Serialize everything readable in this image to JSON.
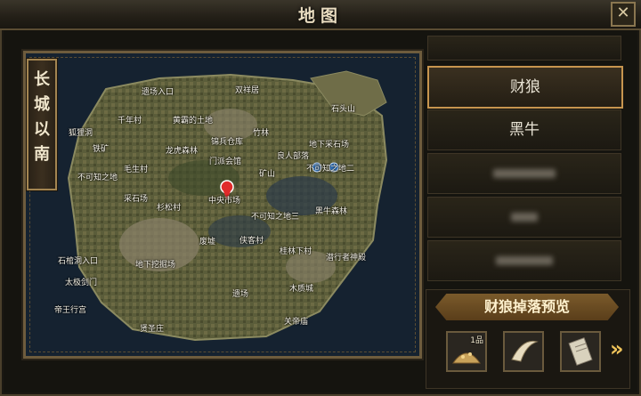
{
  "window": {
    "title": "地图",
    "close_label": "✕"
  },
  "map": {
    "banner_text": [
      "长",
      "城",
      "以",
      "南"
    ],
    "labels": [
      "遗场入口",
      "双祥居",
      "狐狸洞",
      "千年村",
      "黄霸的土地",
      "竹林",
      "石头山",
      "铁矿",
      "龙虎森林",
      "锦兵仓库",
      "良人部落",
      "地下采石场",
      "门派会馆",
      "毛生村",
      "矿山",
      "不可知之地",
      "不可知之地二",
      "采石场",
      "中央市场",
      "杉松村",
      "不可知之地三",
      "黑牛森林",
      "废墟",
      "侠客村",
      "桂林下村",
      "潜行者神殿",
      "石棺洞入口",
      "地下挖掘场",
      "太极剑门",
      "帝王行宫",
      "遗场",
      "木质城",
      "关帝庙",
      "贤圣庄"
    ],
    "marker_icon": "map-pin-icon"
  },
  "monsters": {
    "items": [
      "财狼",
      "黑牛"
    ],
    "selected": "财狼"
  },
  "drops": {
    "title": "财狼掉落预览",
    "slots": [
      {
        "icon": "gold-pile-icon",
        "qty": "1品"
      },
      {
        "icon": "horn-icon",
        "qty": ""
      },
      {
        "icon": "scroll-icon",
        "qty": ""
      }
    ],
    "next_icon": "double-chevron-right-icon"
  }
}
